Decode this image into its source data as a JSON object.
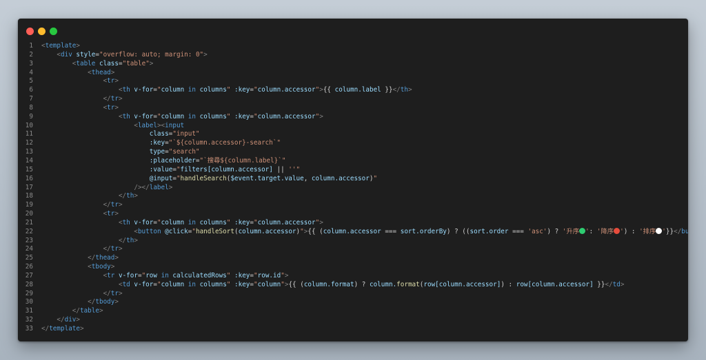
{
  "window": {
    "controls": [
      {
        "name": "close",
        "color": "#ff5f57"
      },
      {
        "name": "minimize",
        "color": "#febc2e"
      },
      {
        "name": "maximize",
        "color": "#28c840"
      }
    ]
  },
  "colors": {
    "tag": "#569cd6",
    "bracket": "#808080",
    "attr": "#9cdcfe",
    "string": "#ce9178",
    "plain": "#d4d4d4",
    "function": "#dcdcaa",
    "line_number": "#8a8a8a",
    "background": "#1e1e1e"
  },
  "code": {
    "lines": [
      {
        "n": "1",
        "indent": 0,
        "tokens": [
          [
            "b",
            "<"
          ],
          [
            "tag",
            "template"
          ],
          [
            "b",
            ">"
          ]
        ]
      },
      {
        "n": "2",
        "indent": 4,
        "tokens": [
          [
            "b",
            "<"
          ],
          [
            "tag",
            "div"
          ],
          [
            "p",
            " "
          ],
          [
            "attr",
            "style"
          ],
          [
            "p",
            "="
          ],
          [
            "str",
            "\"overflow: auto; margin: 0\""
          ],
          [
            "b",
            ">"
          ]
        ]
      },
      {
        "n": "3",
        "indent": 8,
        "tokens": [
          [
            "b",
            "<"
          ],
          [
            "tag",
            "table"
          ],
          [
            "p",
            " "
          ],
          [
            "attr",
            "class"
          ],
          [
            "p",
            "="
          ],
          [
            "str",
            "\"table\""
          ],
          [
            "b",
            ">"
          ]
        ]
      },
      {
        "n": "4",
        "indent": 12,
        "tokens": [
          [
            "b",
            "<"
          ],
          [
            "tag",
            "thead"
          ],
          [
            "b",
            ">"
          ]
        ]
      },
      {
        "n": "5",
        "indent": 16,
        "tokens": [
          [
            "b",
            "<"
          ],
          [
            "tag",
            "tr"
          ],
          [
            "b",
            ">"
          ]
        ]
      },
      {
        "n": "6",
        "indent": 20,
        "tokens": [
          [
            "b",
            "<"
          ],
          [
            "tag",
            "th"
          ],
          [
            "p",
            " "
          ],
          [
            "attr",
            "v-for"
          ],
          [
            "p",
            "="
          ],
          [
            "str",
            "\""
          ],
          [
            "var",
            "column"
          ],
          [
            "p",
            " "
          ],
          [
            "kw",
            "in"
          ],
          [
            "p",
            " "
          ],
          [
            "var",
            "columns"
          ],
          [
            "str",
            "\""
          ],
          [
            "p",
            " "
          ],
          [
            "attr",
            ":key"
          ],
          [
            "p",
            "="
          ],
          [
            "str",
            "\""
          ],
          [
            "var",
            "column.accessor"
          ],
          [
            "str",
            "\""
          ],
          [
            "b",
            ">"
          ],
          [
            "p",
            "{{ "
          ],
          [
            "var",
            "column.label"
          ],
          [
            "p",
            " }}"
          ],
          [
            "b",
            "</"
          ],
          [
            "tag",
            "th"
          ],
          [
            "b",
            ">"
          ]
        ]
      },
      {
        "n": "7",
        "indent": 16,
        "tokens": [
          [
            "b",
            "</"
          ],
          [
            "tag",
            "tr"
          ],
          [
            "b",
            ">"
          ]
        ]
      },
      {
        "n": "8",
        "indent": 16,
        "tokens": [
          [
            "b",
            "<"
          ],
          [
            "tag",
            "tr"
          ],
          [
            "b",
            ">"
          ]
        ]
      },
      {
        "n": "9",
        "indent": 20,
        "tokens": [
          [
            "b",
            "<"
          ],
          [
            "tag",
            "th"
          ],
          [
            "p",
            " "
          ],
          [
            "attr",
            "v-for"
          ],
          [
            "p",
            "="
          ],
          [
            "str",
            "\""
          ],
          [
            "var",
            "column"
          ],
          [
            "p",
            " "
          ],
          [
            "kw",
            "in"
          ],
          [
            "p",
            " "
          ],
          [
            "var",
            "columns"
          ],
          [
            "str",
            "\""
          ],
          [
            "p",
            " "
          ],
          [
            "attr",
            ":key"
          ],
          [
            "p",
            "="
          ],
          [
            "str",
            "\""
          ],
          [
            "var",
            "column.accessor"
          ],
          [
            "str",
            "\""
          ],
          [
            "b",
            ">"
          ]
        ]
      },
      {
        "n": "10",
        "indent": 24,
        "tokens": [
          [
            "b",
            "<"
          ],
          [
            "tag",
            "label"
          ],
          [
            "b",
            "><"
          ],
          [
            "tag",
            "input"
          ]
        ]
      },
      {
        "n": "11",
        "indent": 28,
        "tokens": [
          [
            "attr",
            "class"
          ],
          [
            "p",
            "="
          ],
          [
            "str",
            "\"input\""
          ]
        ]
      },
      {
        "n": "12",
        "indent": 28,
        "tokens": [
          [
            "attr",
            ":key"
          ],
          [
            "p",
            "="
          ],
          [
            "str",
            "\"`${column.accessor}-search`\""
          ]
        ]
      },
      {
        "n": "13",
        "indent": 28,
        "tokens": [
          [
            "attr",
            "type"
          ],
          [
            "p",
            "="
          ],
          [
            "str",
            "\"search\""
          ]
        ]
      },
      {
        "n": "14",
        "indent": 28,
        "tokens": [
          [
            "attr",
            ":placeholder"
          ],
          [
            "p",
            "="
          ],
          [
            "str",
            "\"`搜尋${column.label}`\""
          ]
        ]
      },
      {
        "n": "15",
        "indent": 28,
        "tokens": [
          [
            "attr",
            ":value"
          ],
          [
            "p",
            "="
          ],
          [
            "str",
            "\""
          ],
          [
            "var",
            "filters[column.accessor]"
          ],
          [
            "p",
            " || "
          ],
          [
            "str",
            "''"
          ],
          [
            "str",
            "\""
          ]
        ]
      },
      {
        "n": "16",
        "indent": 28,
        "tokens": [
          [
            "attr",
            "@input"
          ],
          [
            "p",
            "="
          ],
          [
            "str",
            "\""
          ],
          [
            "fn",
            "handleSearch"
          ],
          [
            "p",
            "("
          ],
          [
            "var",
            "$event.target.value"
          ],
          [
            "p",
            ", "
          ],
          [
            "var",
            "column.accessor"
          ],
          [
            "p",
            ")"
          ],
          [
            "str",
            "\""
          ]
        ]
      },
      {
        "n": "17",
        "indent": 24,
        "tokens": [
          [
            "b",
            "/></"
          ],
          [
            "tag",
            "label"
          ],
          [
            "b",
            ">"
          ]
        ]
      },
      {
        "n": "18",
        "indent": 20,
        "tokens": [
          [
            "b",
            "</"
          ],
          [
            "tag",
            "th"
          ],
          [
            "b",
            ">"
          ]
        ]
      },
      {
        "n": "19",
        "indent": 16,
        "tokens": [
          [
            "b",
            "</"
          ],
          [
            "tag",
            "tr"
          ],
          [
            "b",
            ">"
          ]
        ]
      },
      {
        "n": "20",
        "indent": 16,
        "tokens": [
          [
            "b",
            "<"
          ],
          [
            "tag",
            "tr"
          ],
          [
            "b",
            ">"
          ]
        ]
      },
      {
        "n": "21",
        "indent": 20,
        "tokens": [
          [
            "b",
            "<"
          ],
          [
            "tag",
            "th"
          ],
          [
            "p",
            " "
          ],
          [
            "attr",
            "v-for"
          ],
          [
            "p",
            "="
          ],
          [
            "str",
            "\""
          ],
          [
            "var",
            "column"
          ],
          [
            "p",
            " "
          ],
          [
            "kw",
            "in"
          ],
          [
            "p",
            " "
          ],
          [
            "var",
            "columns"
          ],
          [
            "str",
            "\""
          ],
          [
            "p",
            " "
          ],
          [
            "attr",
            ":key"
          ],
          [
            "p",
            "="
          ],
          [
            "str",
            "\""
          ],
          [
            "var",
            "column.accessor"
          ],
          [
            "str",
            "\""
          ],
          [
            "b",
            ">"
          ]
        ]
      },
      {
        "n": "22",
        "indent": 24,
        "tokens": [
          [
            "b",
            "<"
          ],
          [
            "tag",
            "button"
          ],
          [
            "p",
            " "
          ],
          [
            "attr",
            "@click"
          ],
          [
            "p",
            "="
          ],
          [
            "str",
            "\""
          ],
          [
            "fn",
            "handleSort"
          ],
          [
            "p",
            "("
          ],
          [
            "var",
            "column.accessor"
          ],
          [
            "p",
            ")"
          ],
          [
            "str",
            "\""
          ],
          [
            "b",
            ">"
          ],
          [
            "p",
            "{{ ("
          ],
          [
            "var",
            "column.accessor"
          ],
          [
            "p",
            " === "
          ],
          [
            "var",
            "sort.orderBy"
          ],
          [
            "p",
            ") ? (("
          ],
          [
            "var",
            "sort.order"
          ],
          [
            "p",
            " === "
          ],
          [
            "str",
            "'asc'"
          ],
          [
            "p",
            ") ? "
          ],
          [
            "str",
            "'升序"
          ],
          [
            "dot",
            "#2ecc71"
          ],
          [
            "str",
            "'"
          ],
          [
            "p",
            ": "
          ],
          [
            "str",
            "'降序"
          ],
          [
            "dot",
            "#e74c3c"
          ],
          [
            "str",
            "'"
          ],
          [
            "p",
            ") : "
          ],
          [
            "str",
            "'排序"
          ],
          [
            "dot",
            "#ffffff"
          ],
          [
            "str",
            "'"
          ],
          [
            "p",
            "}}"
          ],
          [
            "b",
            "</"
          ],
          [
            "tag",
            "button"
          ],
          [
            "b",
            ">"
          ]
        ]
      },
      {
        "n": "23",
        "indent": 20,
        "tokens": [
          [
            "b",
            "</"
          ],
          [
            "tag",
            "th"
          ],
          [
            "b",
            ">"
          ]
        ]
      },
      {
        "n": "24",
        "indent": 16,
        "tokens": [
          [
            "b",
            "</"
          ],
          [
            "tag",
            "tr"
          ],
          [
            "b",
            ">"
          ]
        ]
      },
      {
        "n": "25",
        "indent": 12,
        "tokens": [
          [
            "b",
            "</"
          ],
          [
            "tag",
            "thead"
          ],
          [
            "b",
            ">"
          ]
        ]
      },
      {
        "n": "26",
        "indent": 12,
        "tokens": [
          [
            "b",
            "<"
          ],
          [
            "tag",
            "tbody"
          ],
          [
            "b",
            ">"
          ]
        ]
      },
      {
        "n": "27",
        "indent": 16,
        "tokens": [
          [
            "b",
            "<"
          ],
          [
            "tag",
            "tr"
          ],
          [
            "p",
            " "
          ],
          [
            "attr",
            "v-for"
          ],
          [
            "p",
            "="
          ],
          [
            "str",
            "\""
          ],
          [
            "var",
            "row"
          ],
          [
            "p",
            " "
          ],
          [
            "kw",
            "in"
          ],
          [
            "p",
            " "
          ],
          [
            "var",
            "calculatedRows"
          ],
          [
            "str",
            "\""
          ],
          [
            "p",
            " "
          ],
          [
            "attr",
            ":key"
          ],
          [
            "p",
            "="
          ],
          [
            "str",
            "\""
          ],
          [
            "var",
            "row.id"
          ],
          [
            "str",
            "\""
          ],
          [
            "b",
            ">"
          ]
        ]
      },
      {
        "n": "28",
        "indent": 20,
        "tokens": [
          [
            "b",
            "<"
          ],
          [
            "tag",
            "td"
          ],
          [
            "p",
            " "
          ],
          [
            "attr",
            "v-for"
          ],
          [
            "p",
            "="
          ],
          [
            "str",
            "\""
          ],
          [
            "var",
            "column"
          ],
          [
            "p",
            " "
          ],
          [
            "kw",
            "in"
          ],
          [
            "p",
            " "
          ],
          [
            "var",
            "columns"
          ],
          [
            "str",
            "\""
          ],
          [
            "p",
            " "
          ],
          [
            "attr",
            ":key"
          ],
          [
            "p",
            "="
          ],
          [
            "str",
            "\""
          ],
          [
            "var",
            "column"
          ],
          [
            "str",
            "\""
          ],
          [
            "b",
            ">"
          ],
          [
            "p",
            "{{ ("
          ],
          [
            "var",
            "column.format"
          ],
          [
            "p",
            ") ? "
          ],
          [
            "var",
            "column."
          ],
          [
            "fn",
            "format"
          ],
          [
            "p",
            "("
          ],
          [
            "var",
            "row[column.accessor]"
          ],
          [
            "p",
            ") : "
          ],
          [
            "var",
            "row[column.accessor]"
          ],
          [
            "p",
            " }}"
          ],
          [
            "b",
            "</"
          ],
          [
            "tag",
            "td"
          ],
          [
            "b",
            ">"
          ]
        ]
      },
      {
        "n": "29",
        "indent": 16,
        "tokens": [
          [
            "b",
            "</"
          ],
          [
            "tag",
            "tr"
          ],
          [
            "b",
            ">"
          ]
        ]
      },
      {
        "n": "30",
        "indent": 12,
        "tokens": [
          [
            "b",
            "</"
          ],
          [
            "tag",
            "tbody"
          ],
          [
            "b",
            ">"
          ]
        ]
      },
      {
        "n": "31",
        "indent": 8,
        "tokens": [
          [
            "b",
            "</"
          ],
          [
            "tag",
            "table"
          ],
          [
            "b",
            ">"
          ]
        ]
      },
      {
        "n": "32",
        "indent": 4,
        "tokens": [
          [
            "b",
            "</"
          ],
          [
            "tag",
            "div"
          ],
          [
            "b",
            ">"
          ]
        ]
      },
      {
        "n": "33",
        "indent": 0,
        "tokens": [
          [
            "b",
            "</"
          ],
          [
            "tag",
            "template"
          ],
          [
            "b",
            ">"
          ]
        ]
      }
    ]
  }
}
